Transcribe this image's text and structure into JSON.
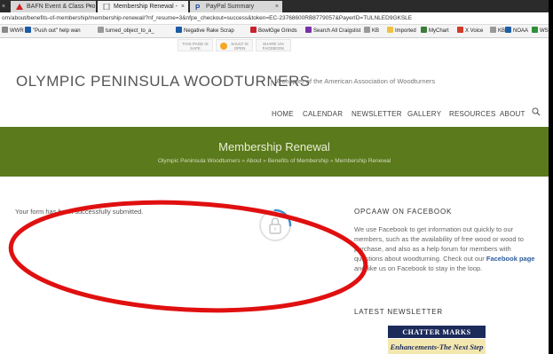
{
  "browser": {
    "tabs": [
      {
        "label": "BAFN Event & Class Pro",
        "active": false
      },
      {
        "label": "Membership Renewal -",
        "active": true
      },
      {
        "label": "PayPal Summary",
        "active": false
      }
    ],
    "close_glyph": "×",
    "address": "om/about/benefits-of-membership/membership-renewal/?nf_resume=3&nfpe_checkout=success&token=EC-23768600RB8779057&PayerID=TULNLED9GKSLE",
    "bookmarks": [
      {
        "label": "WWR",
        "icon": "bookmark-icon",
        "color": "#888"
      },
      {
        "label": "\"Push out\" help wan",
        "icon": "trello-icon",
        "color": "#1b5aa6"
      },
      {
        "label": "turned_object_to_a_",
        "icon": "page-icon",
        "color": "#999"
      },
      {
        "label": "Negative Rake Scrap",
        "icon": "trello-icon",
        "color": "#1b5aa6"
      },
      {
        "label": "BowlGge Grinds",
        "icon": "pinterest-icon",
        "color": "#c8232c"
      },
      {
        "label": "Search All Craigslist",
        "icon": "craigslist-icon",
        "color": "#7b2fa8"
      },
      {
        "label": "KB",
        "icon": "page-icon",
        "color": "#999"
      },
      {
        "label": "Imported",
        "icon": "folder-icon",
        "color": "#f0c040"
      },
      {
        "label": "MyChart",
        "icon": "mychart-icon",
        "color": "#3a7d3a"
      },
      {
        "label": "X Voice",
        "icon": "xvoice-icon",
        "color": "#d43a2a"
      },
      {
        "label": "KB",
        "icon": "page-icon",
        "color": "#999"
      },
      {
        "label": "NOAA",
        "icon": "noaa-icon",
        "color": "#1f5fa8"
      },
      {
        "label": "WS",
        "icon": "globe-icon",
        "color": "#2f8f3a"
      }
    ],
    "share_buttons": [
      {
        "label": "THIS PAGE IS SAFE"
      },
      {
        "label": "SAULT IS OPEN"
      },
      {
        "label": "SHARE VIA FACEBOOK"
      }
    ]
  },
  "site": {
    "title": "OLYMPIC PENINSULA WOODTURNERS",
    "tagline": "A chapter of the American Association of Woodturners"
  },
  "nav": {
    "items": [
      "HOME",
      "CALENDAR",
      "NEWSLETTER",
      "GALLERY",
      "RESOURCES",
      "ABOUT"
    ]
  },
  "banner": {
    "title": "Membership Renewal",
    "breadcrumb": [
      "Olympic Peninsula Woodturners",
      "About",
      "Benefits of Membership",
      "Membership Renewal"
    ],
    "separator": "»"
  },
  "main": {
    "success_message": "Your form has been successfully submitted."
  },
  "sidebar": {
    "facebook_heading": "OPCAAW ON FACEBOOK",
    "facebook_text_1": "We use Facebook to get information out quickly to our members, such as the availability of free wood or wood to purchase, and also as a help forum for members with questions about woodturning. Check out our ",
    "facebook_link": "Facebook page",
    "facebook_text_2": " and like us on Facebook to stay in the loop.",
    "newsletter_heading": "LATEST NEWSLETTER",
    "newsletter_logo_top": "CHATTER MARKS",
    "newsletter_logo_bottom": "Enhancements-The Next Step"
  },
  "colors": {
    "banner_green": "#5b7a1b",
    "annotation_red": "#e01010",
    "link_blue": "#2c5d9a",
    "spinner_blue": "#3a8fd0"
  }
}
